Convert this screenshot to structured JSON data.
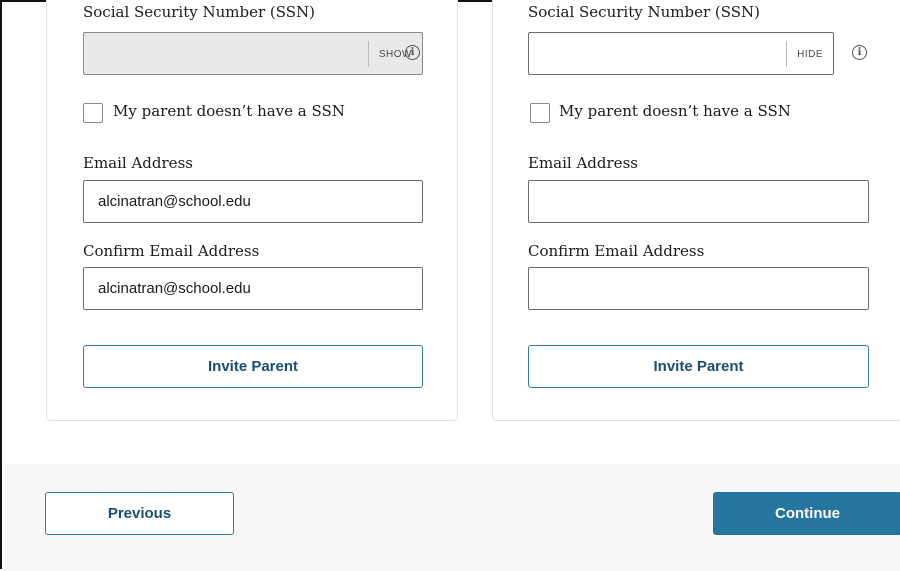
{
  "parents": [
    {
      "ssn_label": "Social Security Number (SSN)",
      "ssn_value": "",
      "ssn_toggle": "SHOW",
      "no_ssn_label": "My parent doesn’t have a SSN",
      "email_label": "Email Address",
      "email_value": "alcinatran@school.edu",
      "confirm_label": "Confirm Email Address",
      "confirm_value": "alcinatran@school.edu",
      "invite_label": "Invite Parent"
    },
    {
      "ssn_label": "Social Security Number (SSN)",
      "ssn_value": "",
      "ssn_toggle": "HIDE",
      "no_ssn_label": "My parent doesn’t have a SSN",
      "email_label": "Email Address",
      "email_value": "",
      "confirm_label": "Confirm Email Address",
      "confirm_value": "",
      "invite_label": "Invite Parent"
    }
  ],
  "info_icon_glyph": "i",
  "footer": {
    "previous_label": "Previous",
    "continue_label": "Continue"
  },
  "colors": {
    "primary": "#25759f",
    "outline_border": "#2e7ca8",
    "footer_bg": "#f7f7f7"
  }
}
